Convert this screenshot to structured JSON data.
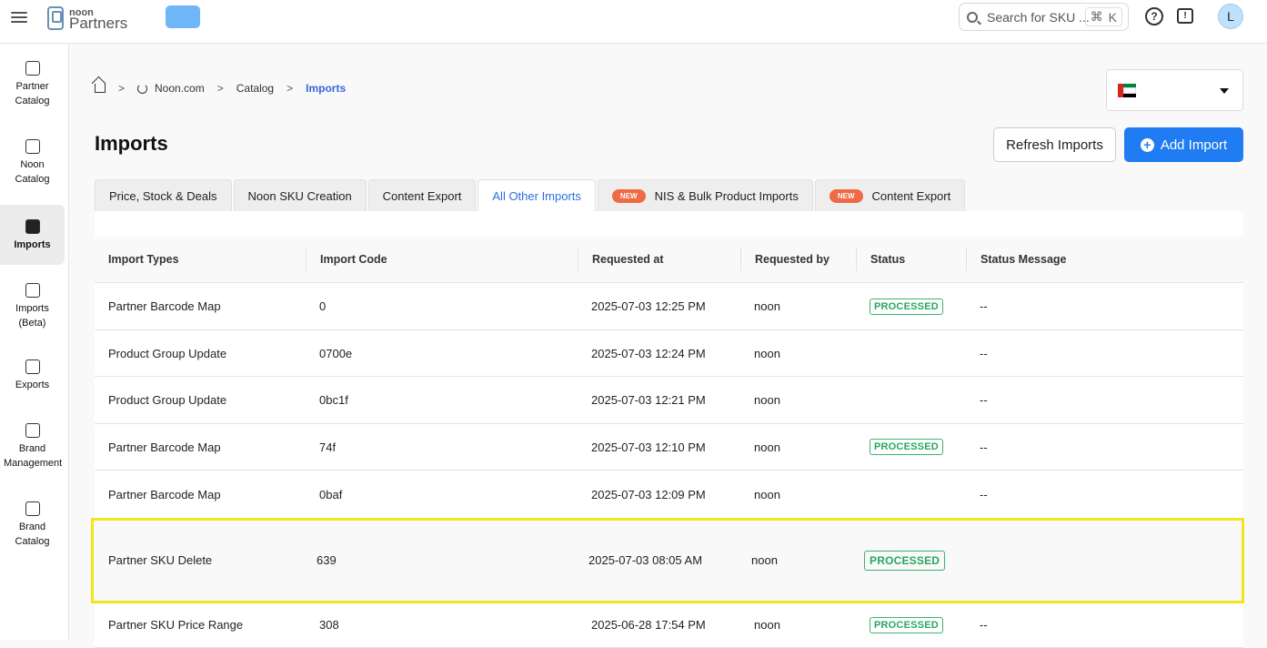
{
  "topbar": {
    "logo_small": "noon",
    "logo_big": "Partners",
    "search_placeholder": "Search for SKU ...",
    "search_shortcut_symbol": "⌘",
    "search_shortcut_key": "K",
    "avatar_initial": "L"
  },
  "sidebar": {
    "items": [
      {
        "label": "Partner Catalog",
        "icon": "catalog-box-icon"
      },
      {
        "label": "Noon Catalog",
        "icon": "noon-catalog-icon"
      },
      {
        "label": "Imports",
        "icon": "import-icon",
        "active": true
      },
      {
        "label": "Imports (Beta)",
        "icon": "import-beta-icon"
      },
      {
        "label": "Exports",
        "icon": "export-icon"
      },
      {
        "label": "Brand Management",
        "icon": "brand-icon"
      },
      {
        "label": "Brand Catalog",
        "icon": "brand-catalog-icon"
      }
    ]
  },
  "breadcrumb": {
    "site": "Noon.com",
    "section": "Catalog",
    "current": "Imports"
  },
  "country": {
    "flag": "UAE",
    "colors": {
      "red": "#d7261e",
      "green": "#00843d",
      "white": "#ffffff",
      "black": "#000000"
    }
  },
  "page": {
    "title": "Imports",
    "refresh_label": "Refresh Imports",
    "add_label": "Add Import",
    "accent_color": "#1f7cf2"
  },
  "tabs": [
    {
      "label": "Price, Stock & Deals"
    },
    {
      "label": "Noon SKU Creation"
    },
    {
      "label": "Content Export"
    },
    {
      "label": "All Other Imports",
      "active": true
    },
    {
      "label": "NIS & Bulk Product Imports",
      "badge": "NEW"
    },
    {
      "label": "Content Export",
      "badge": "NEW"
    }
  ],
  "table": {
    "columns": [
      "Import Types",
      "Import Code",
      "Requested at",
      "Requested by",
      "Status",
      "Status Message"
    ],
    "rows": [
      {
        "type": "Partner Barcode Map",
        "code": "0",
        "requested_at": "2025-07-03 12:25 PM",
        "requested_by": "noon",
        "status": "PROCESSED",
        "message": "--"
      },
      {
        "type": "Product Group Update",
        "code": "0700e",
        "requested_at": "2025-07-03 12:24 PM",
        "requested_by": "noon",
        "status": "",
        "message": "--"
      },
      {
        "type": "Product Group Update",
        "code": "0bc1f",
        "requested_at": "2025-07-03 12:21 PM",
        "requested_by": "noon",
        "status": "",
        "message": "--"
      },
      {
        "type": "Partner Barcode Map",
        "code": "74f",
        "requested_at": "2025-07-03 12:10 PM",
        "requested_by": "noon",
        "status": "PROCESSED",
        "message": "--"
      },
      {
        "type": "Partner Barcode Map",
        "code": "0baf",
        "requested_at": "2025-07-03 12:09 PM",
        "requested_by": "noon",
        "status": "",
        "message": "--"
      },
      {
        "type": "Partner SKU Delete",
        "code": "639",
        "requested_at": "2025-07-03 08:05 AM",
        "requested_by": "noon",
        "status": "PROCESSED",
        "message": ""
      },
      {
        "type": "Partner SKU Price Range",
        "code": "308",
        "requested_at": "2025-06-28 17:54 PM",
        "requested_by": "noon",
        "status": "PROCESSED",
        "message": "--"
      }
    ]
  }
}
